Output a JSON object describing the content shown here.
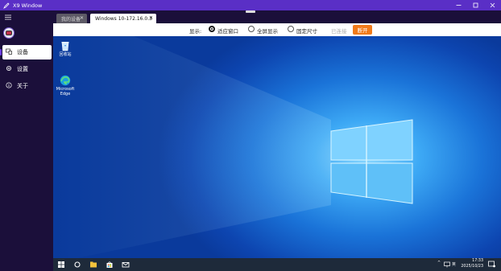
{
  "window": {
    "title": "X9 Window",
    "controls": [
      "minimize",
      "maximize",
      "close"
    ]
  },
  "sidebar": {
    "items": [
      {
        "label": "设备",
        "icon": "devices-icon",
        "active": true
      },
      {
        "label": "设置",
        "icon": "gear-icon",
        "active": false
      },
      {
        "label": "关于",
        "icon": "info-icon",
        "active": false
      }
    ]
  },
  "tabs": [
    {
      "label": "我的设备",
      "active": false
    },
    {
      "label": "Windows 10-172.16.0.3",
      "active": true
    }
  ],
  "toolbar": {
    "display_label": "显示:",
    "options": [
      {
        "label": "适应窗口",
        "selected": true
      },
      {
        "label": "全屏显示",
        "selected": false
      },
      {
        "label": "固定尺寸",
        "selected": false
      }
    ],
    "status": "已连接",
    "disconnect_label": "断开"
  },
  "remote_desktop": {
    "icons": [
      {
        "label": "回收站",
        "icon": "recycle-bin-icon"
      },
      {
        "label": "Microsoft Edge",
        "icon": "edge-icon"
      }
    ],
    "taskbar": {
      "time": "17:33",
      "date": "2025/10/23",
      "ime": "英",
      "apps": [
        "start-icon",
        "search-icon",
        "file-explorer-icon",
        "store-icon",
        "mail-icon"
      ]
    }
  },
  "colors": {
    "titlebar": "#5a2fc6",
    "sidebar": "#1b0f3a",
    "accent_button": "#f07a1a",
    "desktop": "#1a73d8"
  }
}
